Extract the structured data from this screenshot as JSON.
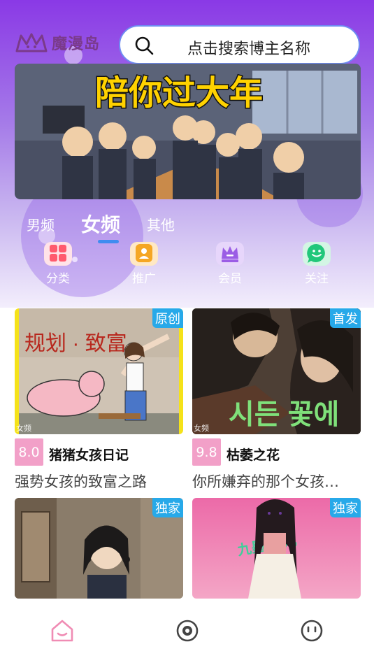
{
  "app": {
    "logo_text": "魔漫岛"
  },
  "search": {
    "placeholder": "点击搜索博主名称"
  },
  "banner": {
    "headline": "陪你过大年"
  },
  "tabs": [
    {
      "label": "男频",
      "active": false
    },
    {
      "label": "女频",
      "active": true
    },
    {
      "label": "其他",
      "active": false
    }
  ],
  "quick_links": [
    {
      "label": "分类",
      "icon": "grid-icon",
      "color": "#ff5a6e"
    },
    {
      "label": "推广",
      "icon": "person-icon",
      "color": "#f5a623"
    },
    {
      "label": "会员",
      "icon": "crown-icon",
      "color": "#9b5de5"
    },
    {
      "label": "关注",
      "icon": "smile-chat-icon",
      "color": "#21c77a"
    }
  ],
  "comics": [
    {
      "badge": "原创",
      "genre": "女频",
      "score": "8.0",
      "title": "猪猪女孩日记",
      "desc": "强势女孩的致富之路",
      "cover_text": "规划 · 致富"
    },
    {
      "badge": "首发",
      "genre": "女频",
      "score": "9.8",
      "title": "枯萎之花",
      "desc": "你所嫌弃的那个女孩…",
      "cover_text": "시든 꽃에"
    },
    {
      "badge": "独家",
      "genre": "",
      "score": "",
      "title": "",
      "desc": "",
      "cover_text": ""
    },
    {
      "badge": "独家",
      "genre": "",
      "score": "",
      "title": "",
      "desc": "",
      "cover_text": "九墨 灵儿"
    }
  ],
  "bottom_nav": [
    {
      "icon": "home-icon",
      "active": true
    },
    {
      "icon": "discover-icon",
      "active": false
    },
    {
      "icon": "profile-icon",
      "active": false
    }
  ],
  "colors": {
    "accent": "#3f8cf0",
    "badge": "#27a9e9",
    "score": "#f2a0c8",
    "home_active": "#f08cb4"
  }
}
